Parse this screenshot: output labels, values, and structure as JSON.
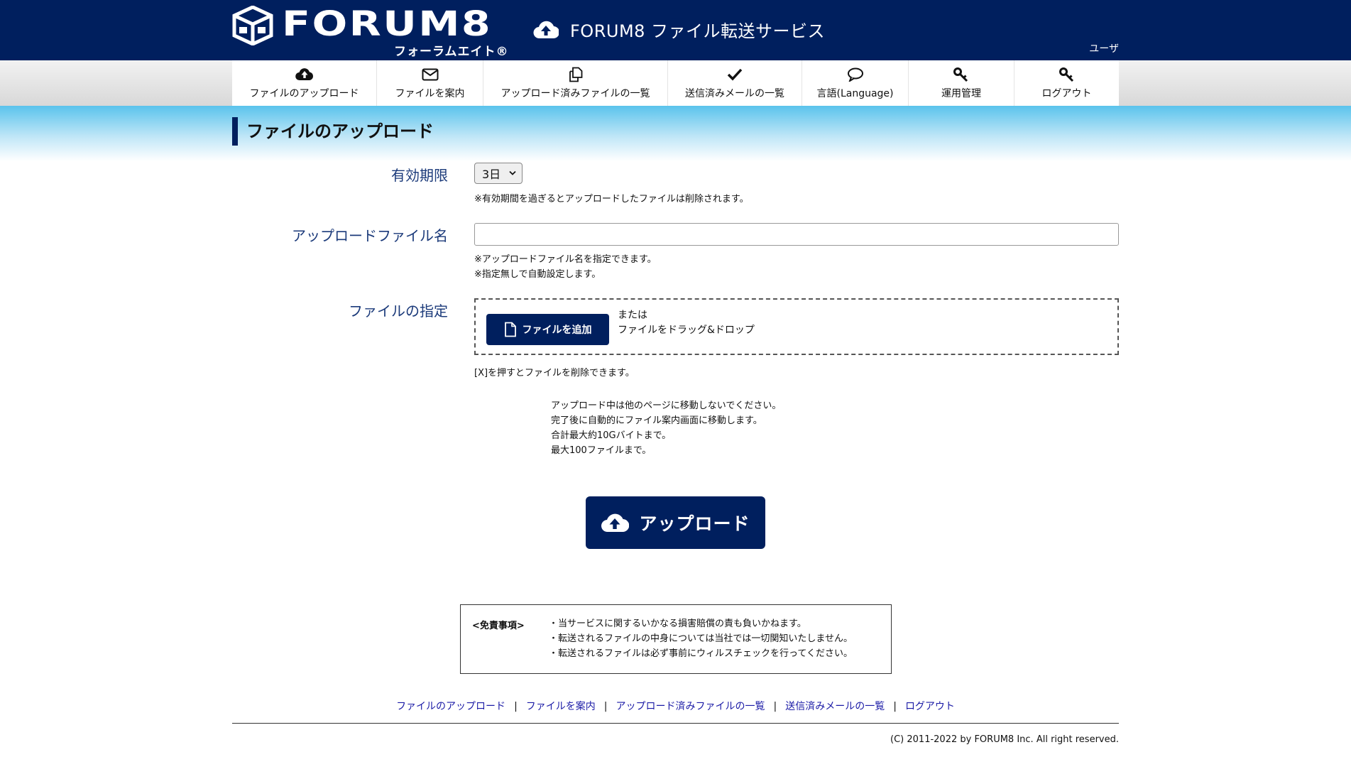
{
  "header": {
    "logo_text": "FORUM8",
    "logo_kana": "フォーラムエイト®",
    "service_title": "FORUM8 ファイル転送サービス",
    "user_label": "ユーザ"
  },
  "nav": {
    "items": [
      {
        "label": "ファイルのアップロード",
        "icon": "cloud-upload-icon"
      },
      {
        "label": "ファイルを案内",
        "icon": "envelope-icon"
      },
      {
        "label": "アップロード済みファイルの一覧",
        "icon": "copy-files-icon"
      },
      {
        "label": "送信済みメールの一覧",
        "icon": "checkmark-icon"
      },
      {
        "label": "言語(Language)",
        "icon": "speech-bubble-icon"
      },
      {
        "label": "運用管理",
        "icon": "key-icon"
      },
      {
        "label": "ログアウト",
        "icon": "key-icon"
      }
    ]
  },
  "page": {
    "title": "ファイルのアップロード"
  },
  "form": {
    "expiry_label": "有効期限",
    "expiry_value": "3日",
    "expiry_note": "※有効期間を過ぎるとアップロードしたファイルは削除されます。",
    "filename_label": "アップロードファイル名",
    "filename_value": "",
    "filename_note1": "※アップロードファイル名を指定できます。",
    "filename_note2": "※指定無しで自動設定します。",
    "file_label": "ファイルの指定",
    "add_file_button": "ファイルを追加",
    "drop_or": "または",
    "drop_text": "ファイルをドラッグ&ドロップ",
    "delete_note": "[X]を押すとファイルを削除できます。",
    "info_lines": [
      "アップロード中は他のページに移動しないでください。",
      "完了後に自動的にファイル案内画面に移動します。",
      "合計最大約10Gバイトまで。",
      "最大100ファイルまで。"
    ],
    "upload_button": "アップロード"
  },
  "disclaimer": {
    "heading": "<免責事項>",
    "items": [
      "・当サービスに関するいかなる損害賠償の責も負いかねます。",
      "・転送されるファイルの中身については当社では一切関知いたしません。",
      "・転送されるファイルは必ず事前にウィルスチェックを行ってください。"
    ]
  },
  "footer": {
    "links": [
      "ファイルのアップロード",
      "ファイルを案内",
      "アップロード済みファイルの一覧",
      "送信済みメールの一覧",
      "ログアウト"
    ],
    "separator": "|",
    "copyright": "(C) 2011-2022 by FORUM8 Inc. All right reserved."
  },
  "colors": {
    "brand_navy": "#001f5e",
    "label_blue": "#1b3a7a",
    "link_blue": "#1a1aa6",
    "band_sky": "#5ac3ec"
  }
}
